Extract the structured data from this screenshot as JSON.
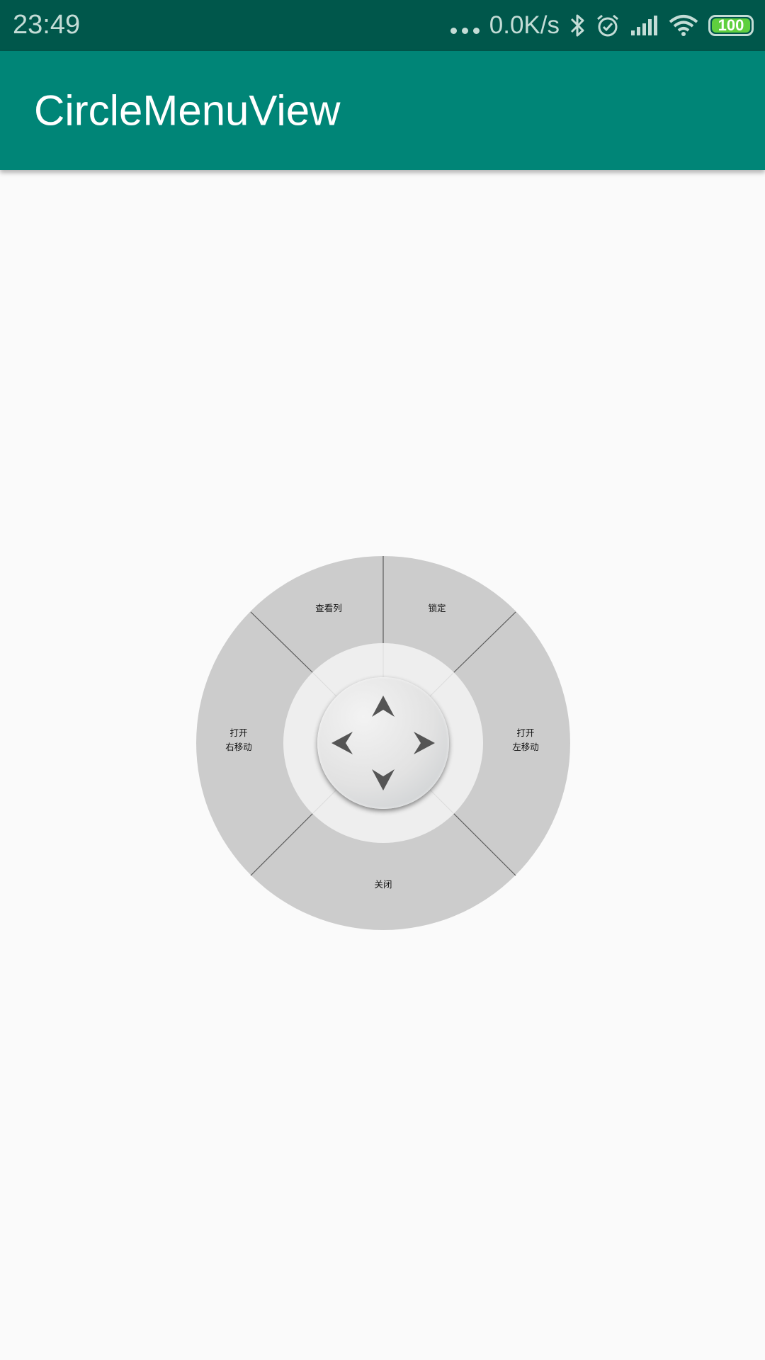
{
  "status_bar": {
    "time": "23:49",
    "net_speed": "0.0K/s",
    "battery": "100",
    "icons": [
      "more-dots-icon",
      "bluetooth-icon",
      "alarm-icon",
      "signal-icon",
      "wifi-icon",
      "battery-icon"
    ]
  },
  "app_bar": {
    "title": "CircleMenuView"
  },
  "circle_menu": {
    "segments": {
      "top_left": "查看列",
      "top_right": "锁定",
      "right_line1": "打开",
      "right_line2": "左移动",
      "left_line1": "打开",
      "left_line2": "右移动",
      "bottom": "关闭"
    },
    "center_icons": [
      "arrow-up-icon",
      "arrow-down-icon",
      "arrow-left-icon",
      "arrow-right-icon"
    ]
  },
  "colors": {
    "status_bar": "#00574b",
    "app_bar": "#008577",
    "background": "#fafafa",
    "outer_ring": "#cccccc",
    "inner_ring": "#eeeeee"
  }
}
